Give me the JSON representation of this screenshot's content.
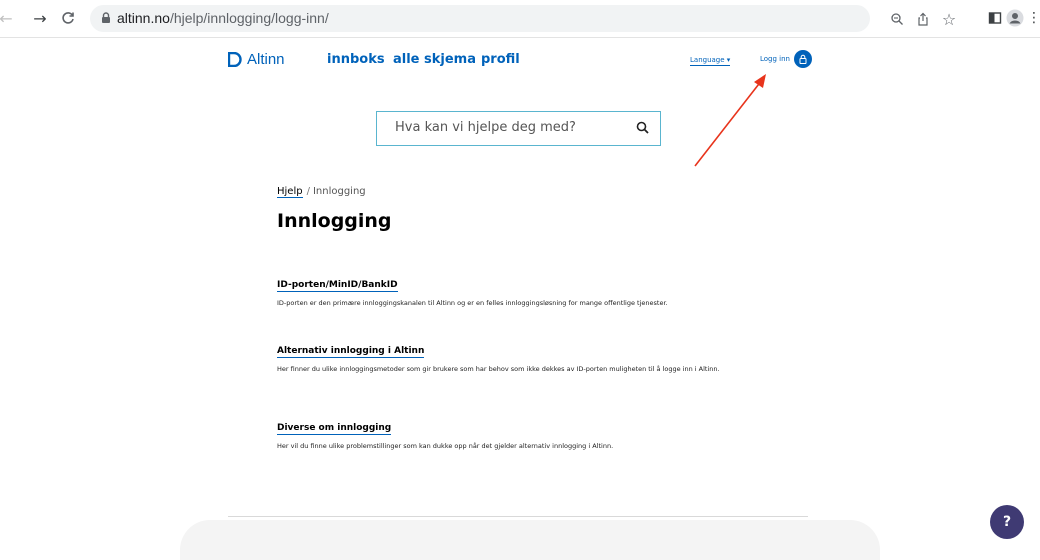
{
  "browser": {
    "url_host": "altinn.no",
    "url_path": "/hjelp/innlogging/logg-inn/"
  },
  "header": {
    "logo_text": "Altinn",
    "nav": [
      "innboks",
      "alle skjema",
      "profil"
    ],
    "language_label": "Language ▾",
    "login_label": "Logg inn"
  },
  "search": {
    "placeholder": "Hva kan vi hjelpe deg med?"
  },
  "breadcrumb": {
    "parent": "Hjelp",
    "separator": "/",
    "current": "Innlogging"
  },
  "page_title": "Innlogging",
  "sections": [
    {
      "title": "ID-porten/MinID/BankID",
      "desc": "ID-porten er den primære innloggingskanalen til Altinn og er en felles innloggingsløsning for mange offentlige tjenester."
    },
    {
      "title": "Alternativ innlogging i Altinn",
      "desc": "Her finner du ulike innloggingsmetoder som gir brukere som har behov som ikke dekkes av ID-porten muligheten til å logge inn i Altinn."
    },
    {
      "title": "Diverse om innlogging",
      "desc": "Her vil du finne ulike problemstillinger som kan dukke opp når det gjelder alternativ innlogging i Altinn."
    }
  ],
  "help_button_label": "?",
  "colors": {
    "brand_blue": "#0062ba",
    "search_border": "#5ab5cf",
    "annotation_arrow": "#e8341c",
    "help_button": "#3f3a73"
  }
}
